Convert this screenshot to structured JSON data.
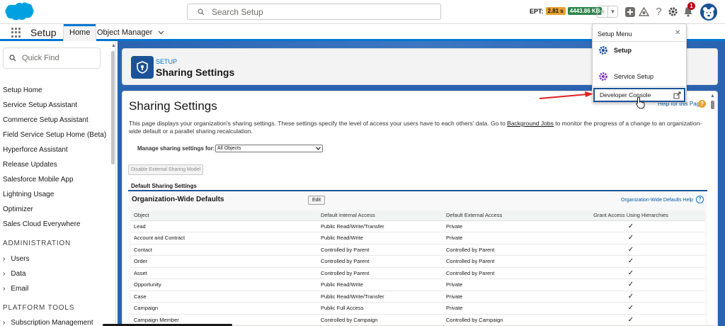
{
  "header": {
    "search_placeholder": "Search Setup",
    "ept_label": "EPT:",
    "ept_time": "2.81 s",
    "ept_size": "4443.86 KB",
    "notification_count": "1",
    "colors": {
      "brand": "#00a1e0",
      "accent": "#0176d3",
      "notification": "#ba0517"
    },
    "icons": [
      "salesforce-cloud-logo",
      "search-icon",
      "star-icon",
      "chevron-down-icon",
      "plus-icon",
      "trailhead-icon",
      "help-icon",
      "gear-icon",
      "bell-icon",
      "bear-avatar-icon"
    ]
  },
  "context_bar": {
    "app_name": "Setup",
    "tabs": [
      {
        "label": "Home",
        "active": true
      },
      {
        "label": "Object Manager",
        "active": false
      }
    ]
  },
  "sidebar": {
    "quick_find_placeholder": "Quick Find",
    "items": [
      "Setup Home",
      "Service Setup Assistant",
      "Commerce Setup Assistant",
      "Field Service Setup Home (Beta)",
      "Hyperforce Assistant",
      "Release Updates",
      "Salesforce Mobile App",
      "Lightning Usage",
      "Optimizer",
      "Sales Cloud Everywhere"
    ],
    "section_admin": "ADMINISTRATION",
    "admin_items": [
      "Users",
      "Data",
      "Email"
    ],
    "section_platform": "PLATFORM TOOLS",
    "platform_items": [
      "Subscription Management"
    ]
  },
  "page_header": {
    "eyebrow": "SETUP",
    "title": "Sharing Settings"
  },
  "main": {
    "title": "Sharing Settings",
    "help_link": "Help for this Page",
    "desc_part1": "This page displays your organization's sharing settings. These settings specify the level of access your users have to each others' data. Go to ",
    "desc_link": "Background Jobs",
    "desc_part2": " to monitor the progress of a change to an organization-wide default or a parallel sharing recalculation.",
    "manage_label": "Manage sharing settings for:",
    "manage_value": "All Objects",
    "disable_button": "Disable External Sharing Model",
    "default_sharing_label": "Default Sharing Settings"
  },
  "owd": {
    "title": "Organization-Wide Defaults",
    "edit_label": "Edit",
    "help_link": "Organization-Wide Defaults Help",
    "columns": [
      "Object",
      "Default Internal Access",
      "Default External Access",
      "Grant Access Using Hierarchies"
    ],
    "rows": [
      {
        "object": "Lead",
        "internal": "Public Read/Write/Transfer",
        "external": "Private",
        "grant": "✓"
      },
      {
        "object": "Account and Contract",
        "internal": "Public Read/Write",
        "external": "Private",
        "grant": "✓"
      },
      {
        "object": "Contact",
        "internal": "Controlled by Parent",
        "external": "Controlled by Parent",
        "grant": "✓"
      },
      {
        "object": "Order",
        "internal": "Controlled by Parent",
        "external": "Controlled by Parent",
        "grant": "✓"
      },
      {
        "object": "Asset",
        "internal": "Controlled by Parent",
        "external": "Controlled by Parent",
        "grant": "✓"
      },
      {
        "object": "Opportunity",
        "internal": "Public Read/Write",
        "external": "Private",
        "grant": "✓"
      },
      {
        "object": "Case",
        "internal": "Public Read/Write/Transfer",
        "external": "Private",
        "grant": "✓"
      },
      {
        "object": "Campaign",
        "internal": "Public Full Access",
        "external": "Private",
        "grant": "✓"
      },
      {
        "object": "Campaign Member",
        "internal": "Controlled by Campaign",
        "external": "Controlled by Campaign",
        "grant": "✓"
      }
    ]
  },
  "setup_menu": {
    "title": "Setup Menu",
    "items": [
      {
        "label": "Setup",
        "bold": true
      },
      {
        "label": "Service Setup",
        "bold": false
      }
    ],
    "developer_console": "Developer Console"
  }
}
